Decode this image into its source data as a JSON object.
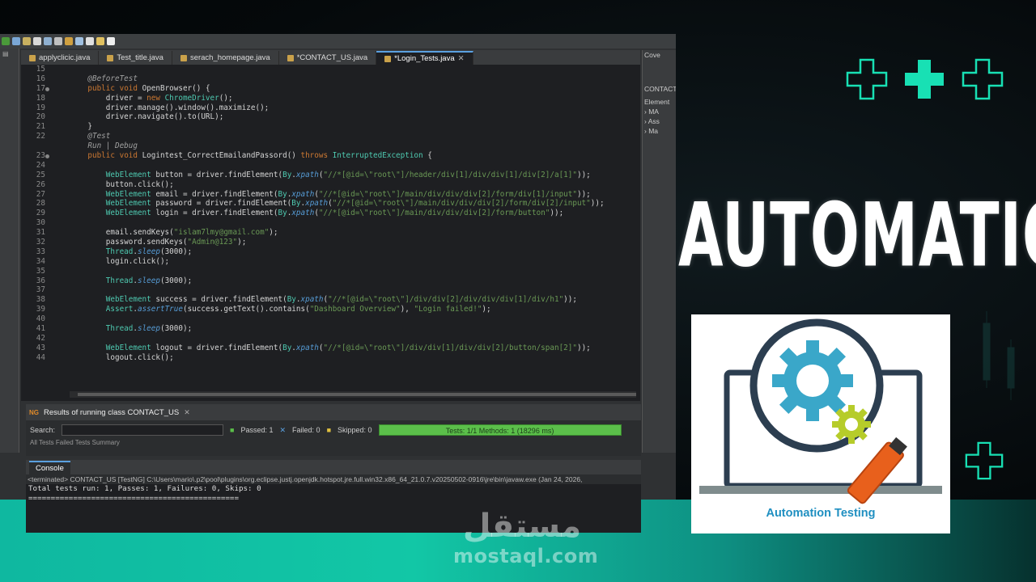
{
  "editor": {
    "tabs": [
      {
        "label": "applyclicic.java",
        "active": false
      },
      {
        "label": "Test_title.java",
        "active": false
      },
      {
        "label": "serach_homepage.java",
        "active": false
      },
      {
        "label": "*CONTACT_US.java",
        "active": false
      },
      {
        "label": "*Login_Tests.java",
        "active": true
      }
    ],
    "lines": [
      {
        "n": "15",
        "t": ""
      },
      {
        "n": "16",
        "t": "    @BeforeTest"
      },
      {
        "n": "17",
        "t": "    public void OpenBrowser() {"
      },
      {
        "n": "18",
        "t": "        driver = new ChromeDriver();"
      },
      {
        "n": "19",
        "t": "        driver.manage().window().maximize();"
      },
      {
        "n": "20",
        "t": "        driver.navigate().to(URL);"
      },
      {
        "n": "21",
        "t": "    }"
      },
      {
        "n": "22",
        "t": "    @Test"
      },
      {
        "n": "",
        "t": "    Run | Debug"
      },
      {
        "n": "23",
        "t": "    public void Logintest_CorrectEmailandPassord() throws InterruptedException {"
      },
      {
        "n": "24",
        "t": ""
      },
      {
        "n": "25",
        "t": "        WebElement button = driver.findElement(By.xpath(\"//*[@id=\\\"root\\\"]/header/div[1]/div/div[1]/div[2]/a[1]\"));"
      },
      {
        "n": "26",
        "t": "        button.click();"
      },
      {
        "n": "27",
        "t": "        WebElement email = driver.findElement(By.xpath(\"//*[@id=\\\"root\\\"]/main/div/div/div[2]/form/div[1]/input\"));"
      },
      {
        "n": "28",
        "t": "        WebElement password = driver.findElement(By.xpath(\"//*[@id=\\\"root\\\"]/main/div/div/div[2]/form/div[2]/input\"));"
      },
      {
        "n": "29",
        "t": "        WebElement login = driver.findElement(By.xpath(\"//*[@id=\\\"root\\\"]/main/div/div/div[2]/form/button\"));"
      },
      {
        "n": "30",
        "t": ""
      },
      {
        "n": "31",
        "t": "        email.sendKeys(\"islam7lmy@gmail.com\");"
      },
      {
        "n": "32",
        "t": "        password.sendKeys(\"Admin@123\");"
      },
      {
        "n": "33",
        "t": "        Thread.sleep(3000);"
      },
      {
        "n": "34",
        "t": "        login.click();"
      },
      {
        "n": "35",
        "t": ""
      },
      {
        "n": "36",
        "t": "        Thread.sleep(3000);"
      },
      {
        "n": "37",
        "t": ""
      },
      {
        "n": "38",
        "t": "        WebElement success = driver.findElement(By.xpath(\"//*[@id=\\\"root\\\"]/div/div[2]/div/div/div[1]/div/h1\"));"
      },
      {
        "n": "39",
        "t": "        Assert.assertTrue(success.getText().contains(\"Dashboard Overview\"), \"Login failed!\");"
      },
      {
        "n": "40",
        "t": ""
      },
      {
        "n": "41",
        "t": "        Thread.sleep(3000);"
      },
      {
        "n": "42",
        "t": ""
      },
      {
        "n": "43",
        "t": "        WebElement logout = driver.findElement(By.xpath(\"//*[@id=\\\"root\\\"]/div/div[1]/div/div[2]/button/span[2]\"));"
      },
      {
        "n": "44",
        "t": "        logout.click();"
      }
    ]
  },
  "side_panel": {
    "items": [
      "Cove",
      "CONTACT",
      "Element",
      "MA",
      "Ass",
      "Ma"
    ]
  },
  "testng": {
    "title": "Results of running class CONTACT_US",
    "search_label": "Search:",
    "passed": "Passed: 1",
    "failed": "Failed: 0",
    "skipped": "Skipped: 0",
    "bar_text": "Tests: 1/1  Methods: 1 (18296 ms)",
    "sub_tabs": "All Tests   Failed Tests   Summary",
    "bar_color": "#5bbf4a"
  },
  "console": {
    "tab_label": "Console",
    "terminated": "<terminated> CONTACT_US [TestNG] C:\\Users\\mario\\.p2\\pool\\plugins\\org.eclipse.justj.openjdk.hotspot.jre.full.win32.x86_64_21.0.7.v20250502-0916\\jre\\bin\\javaw.exe  (Jan 24, 2026,",
    "line1": "Total tests run: 1, Passes: 1, Failures: 0, Skips: 0",
    "line2": "==============================================="
  },
  "promo": {
    "headline": "AUTOMATION",
    "card_caption": "Automation Testing",
    "accent": "#18e0b4"
  },
  "watermark": {
    "arabic": "مستقل",
    "latin": "mostaql.com"
  }
}
